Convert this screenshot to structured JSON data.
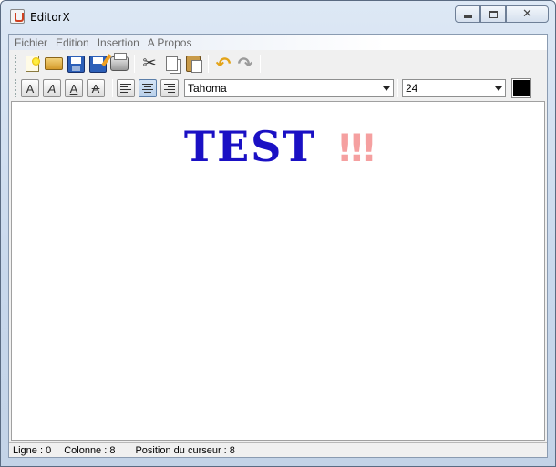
{
  "window": {
    "title": "EditorX",
    "close_glyph": "✕"
  },
  "menubar": {
    "items": [
      "Fichier",
      "Edition",
      "Insertion",
      "A Propos"
    ]
  },
  "toolbar": {
    "icons": [
      "new-icon",
      "open-icon",
      "save-icon",
      "save-as-icon",
      "print-icon",
      "cut-icon",
      "copy-icon",
      "paste-icon",
      "undo-icon",
      "redo-icon"
    ],
    "cut_glyph": "✂",
    "undo_glyph": "↶",
    "redo_glyph": "↷"
  },
  "format_bar": {
    "bold_label": "A",
    "italic_label": "A",
    "underline_label": "A",
    "strike_label": "A",
    "alignment_selected": "center",
    "font_family_value": "Tahoma",
    "font_size_value": "24",
    "text_color": "#000000"
  },
  "document": {
    "word": "TEST",
    "mark": "!!!",
    "word_color": "#1a10c4",
    "mark_color": "#f5a0a0"
  },
  "statusbar": {
    "line": "Ligne : 0",
    "column": "Colonne : 8",
    "cursor": "Position du curseur : 8"
  }
}
